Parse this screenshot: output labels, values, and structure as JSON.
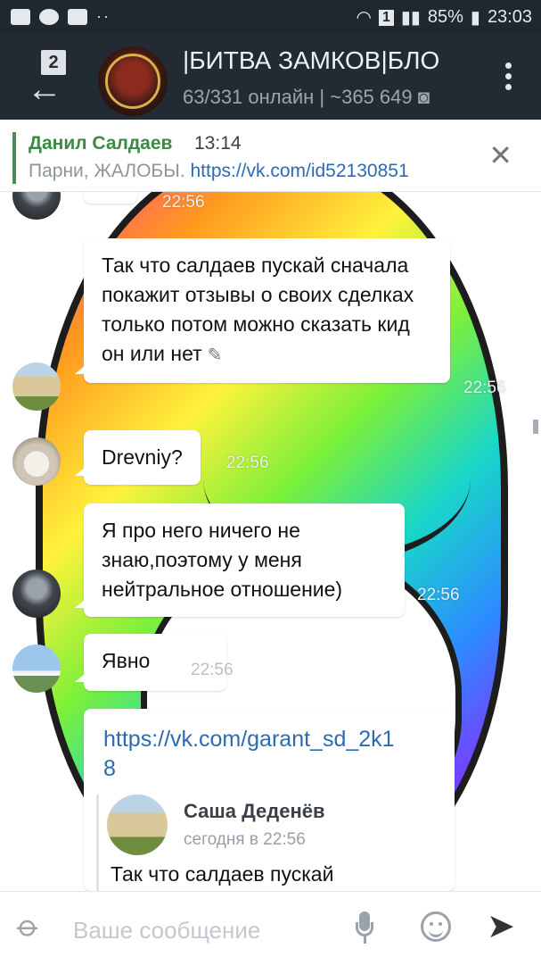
{
  "status_bar": {
    "battery": "85%",
    "time": "23:03",
    "indicator": "1"
  },
  "toolbar": {
    "back_badge": "2",
    "title": "|БИТВА ЗАМКОВ|БЛО",
    "subtitle": "63/331 онлайн | ~365 649 ◙"
  },
  "pinned": {
    "author": "Данил Салдаев",
    "time": "13:14",
    "text_prefix": "Парни, ЖАЛОБЫ. ",
    "link": "https://vk.com/id52130851"
  },
  "messages": [
    {
      "text": "Так что салдаев пускай сначала покажит отзывы о своих сделках только потом можно сказать кид он или нет",
      "time": "22:56",
      "edited": true
    },
    {
      "text": "Drevniy?",
      "time": "22:56"
    },
    {
      "text": "Я про него ничего не знаю,поэтому у меня нейтральное отношение)",
      "time": "22:56"
    },
    {
      "text": "Явно",
      "time": "22:56"
    }
  ],
  "top_partial_time": "22:56",
  "link_message": {
    "url": "https://vk.com/garant_sd_2k18",
    "forward_author": "Саша Деденёв",
    "forward_date": "сегодня в 22:56",
    "forward_text": "Так что салдаев пускай"
  },
  "composer": {
    "placeholder": "Ваше сообщение"
  }
}
